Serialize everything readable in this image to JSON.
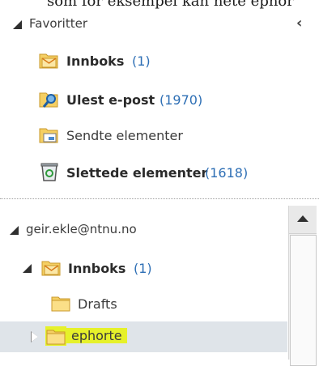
{
  "top_fragment": "som for eksempel kan hete ephor",
  "favorites": {
    "header": "Favoritter",
    "collapse_glyph": "‹",
    "items": [
      {
        "label": "Innboks",
        "count": "(1)",
        "bold": true,
        "icon": "inbox-icon"
      },
      {
        "label": "Ulest e-post",
        "count": "(1970)",
        "bold": true,
        "icon": "search-folder-icon"
      },
      {
        "label": "Sendte elementer",
        "count": "",
        "bold": false,
        "icon": "sent-items-icon"
      },
      {
        "label": "Slettede elementer",
        "count": "(1618)",
        "bold": true,
        "icon": "deleted-items-icon"
      }
    ]
  },
  "account": {
    "header": "geir.ekle@ntnu.no",
    "inbox": {
      "label": "Innboks",
      "count": "(1)"
    },
    "subfolders": [
      {
        "label": "Drafts",
        "selected": false
      },
      {
        "label": "ephorte",
        "selected": true,
        "highlight_color": "#e6f12a"
      }
    ]
  },
  "colors": {
    "count_blue": "#2e6fb5",
    "selection_bg": "#dfe4e9"
  }
}
